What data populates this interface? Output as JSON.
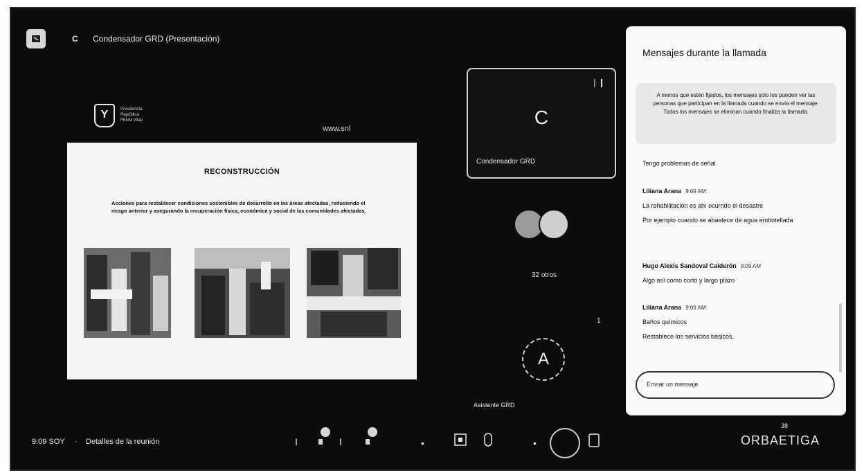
{
  "header": {
    "presenter_initial": "C",
    "presentation_title": "Condensador GRD (Presentación)"
  },
  "slide": {
    "logo_mark": "Y",
    "org_text": "Presidencia\nRepública\nFENM Vitap",
    "website": "www.snl",
    "title": "RECONSTRUCCIÓN",
    "body": "Acciones para restablecer condiciones  sostenibles de desarrollo en las áreas afectadas, reduciendo el riesgo anterior y asegurando  la recuperación física, económica y social de las comunidades afectadas."
  },
  "participants": {
    "main_tile_letter": "C",
    "main_tile_name": "Condensador GRD",
    "others_label": "32 otros",
    "dot_label": "1",
    "assistant_letter": "A",
    "assistant_name": "Asistente GRD"
  },
  "chat": {
    "title": "Mensajes durante la llamada",
    "notice": "A menos que estén fijados, los mensajes solo los pueden ver las personas que participan en la llamada cuando se envía el mensaje. Todos los mensajes se eliminan cuando finaliza la llamada.",
    "messages": [
      {
        "sender": "",
        "time": "",
        "lines": [
          "Tengo problemas de señal"
        ]
      },
      {
        "sender": "Liliana Arana",
        "time": "9:09 AM",
        "lines": [
          "La rehabilitación es ahí ocurrido el desastre",
          "Por ejemplo cuando se abastece de agua embotellada"
        ]
      },
      {
        "sender": "Hugo Alexis Sandoval Calderón",
        "time": "9:09 AM",
        "lines": [
          "Algo así como corto y largo plazo"
        ]
      },
      {
        "sender": "Liliana Arana",
        "time": "9:09 AM",
        "lines": [
          "Baños químicos",
          "Restablece los servicios básicos."
        ]
      }
    ],
    "input_placeholder": "Enviar un mensaje"
  },
  "bottom_bar": {
    "clock": "9:09 SOY",
    "separator": "·",
    "meeting_details": "Detalles de la reunión",
    "corner_count": "38",
    "corner_logo": "ORBAETIGA"
  }
}
